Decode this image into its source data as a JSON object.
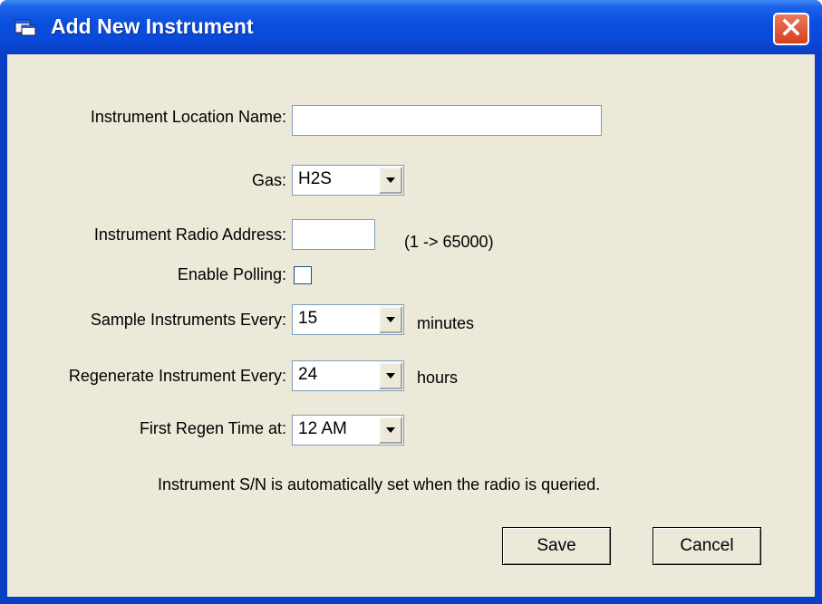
{
  "window": {
    "title": "Add New Instrument"
  },
  "form": {
    "location_label": "Instrument Location Name:",
    "location_value": "",
    "gas_label": "Gas:",
    "gas_value": "H2S",
    "radio_label": "Instrument Radio Address:",
    "radio_value": "",
    "radio_hint": "(1 -> 65000)",
    "polling_label": "Enable Polling:",
    "polling_checked": false,
    "sample_label": "Sample Instruments Every:",
    "sample_value": "15",
    "sample_unit": "minutes",
    "regen_label": "Regenerate Instrument Every:",
    "regen_value": "24",
    "regen_unit": "hours",
    "first_regen_label": "First Regen Time at:",
    "first_regen_value": "12 AM",
    "note": "Instrument S/N is automatically set when the radio is queried."
  },
  "buttons": {
    "save": "Save",
    "cancel": "Cancel"
  },
  "colors": {
    "title_bar": "#0a48d8",
    "client_bg": "#ece9d8",
    "close_button": "#d3401f"
  }
}
